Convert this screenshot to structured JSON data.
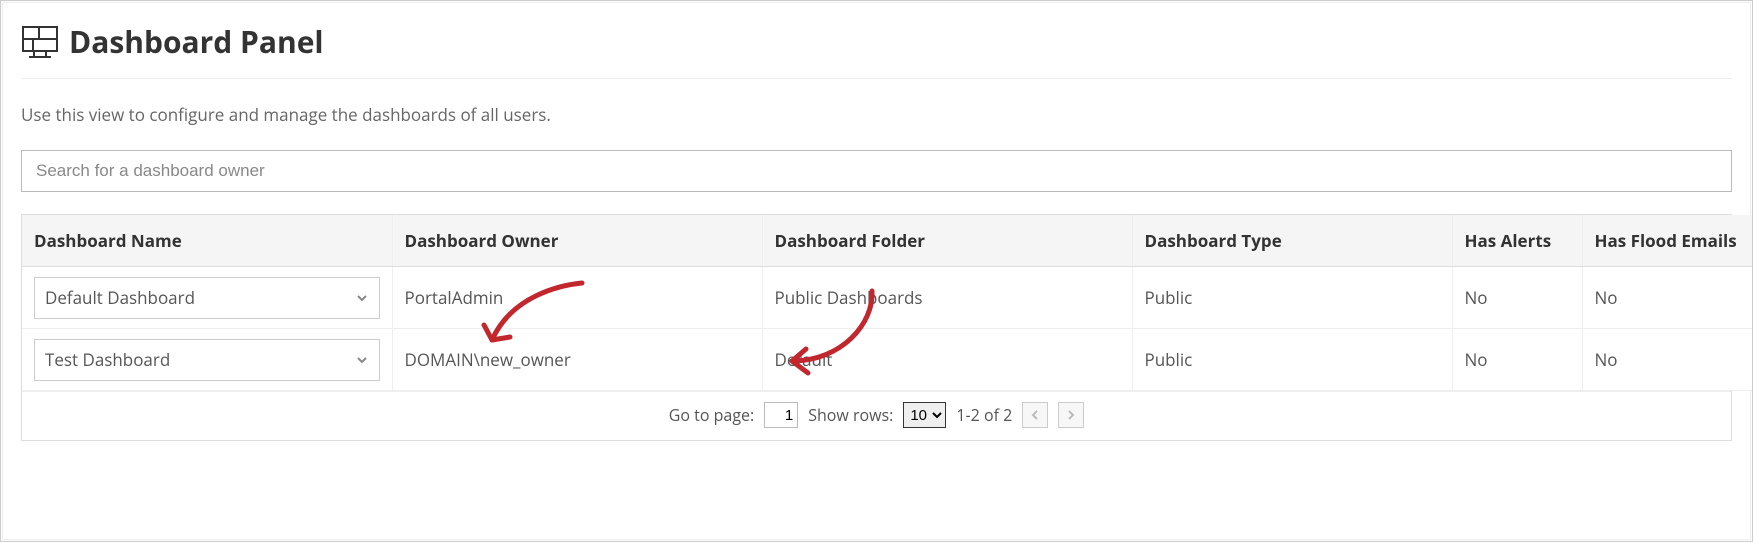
{
  "header": {
    "title": "Dashboard Panel"
  },
  "description": "Use this view to configure and manage the dashboards of all users.",
  "search": {
    "placeholder": "Search for a dashboard owner",
    "value": ""
  },
  "table": {
    "columns": [
      "Dashboard Name",
      "Dashboard Owner",
      "Dashboard Folder",
      "Dashboard Type",
      "Has Alerts",
      "Has Flood Emails"
    ],
    "rows": [
      {
        "name": "Default Dashboard",
        "owner": "PortalAdmin",
        "folder": "Public Dashboards",
        "type": "Public",
        "alerts": "No",
        "flood": "No"
      },
      {
        "name": "Test Dashboard",
        "owner": "DOMAIN\\new_owner",
        "folder": "Default",
        "type": "Public",
        "alerts": "No",
        "flood": "No"
      }
    ]
  },
  "pager": {
    "go_label": "Go to page:",
    "page": "1",
    "rows_label": "Show rows:",
    "rows_value": "10",
    "rows_options": [
      "10"
    ],
    "range": "1-2 of 2"
  },
  "annotation_color": "#c1272d"
}
